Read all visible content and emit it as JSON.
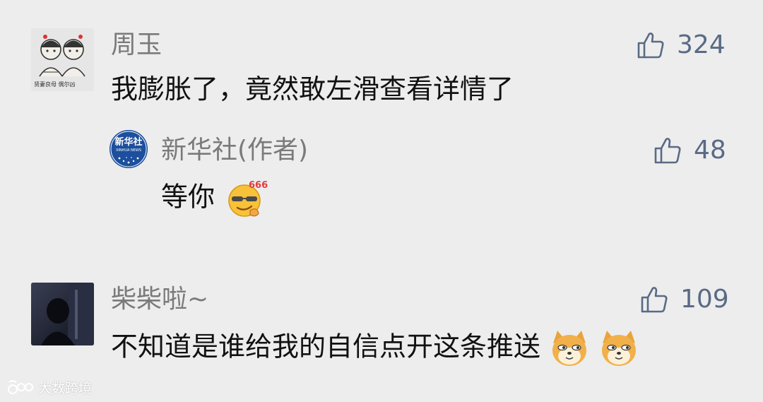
{
  "comments": [
    {
      "author": "周玉",
      "text": "我膨胀了，竟然敢左滑查看详情了",
      "likes": "324",
      "avatar_icon": "sketch-avatar-icon",
      "avatar_caption": "贤妻良母  偶尔凶"
    },
    {
      "author": "新华社(作者)",
      "text": "等你",
      "likes": "48",
      "avatar_icon": "xinhua-logo-icon",
      "avatar_logo_cn": "新华社",
      "avatar_logo_en": "XINHUA NEWS",
      "emoji": "666-emoji-icon",
      "emoji_text": "666"
    },
    {
      "author": "柴柴啦~",
      "text": "不知道是谁给我的自信点开这条推送",
      "likes": "109",
      "avatar_icon": "dark-photo-avatar-icon",
      "emoji": "doge-emoji-icon"
    }
  ],
  "watermark": {
    "text": "大数跨境",
    "icon": "weibo-logo-icon"
  },
  "colors": {
    "background": "#ededed",
    "name": "#7a7a7a",
    "text": "#111111",
    "like": "#5a6a85",
    "xinhua_blue": "#1c4f9c"
  }
}
